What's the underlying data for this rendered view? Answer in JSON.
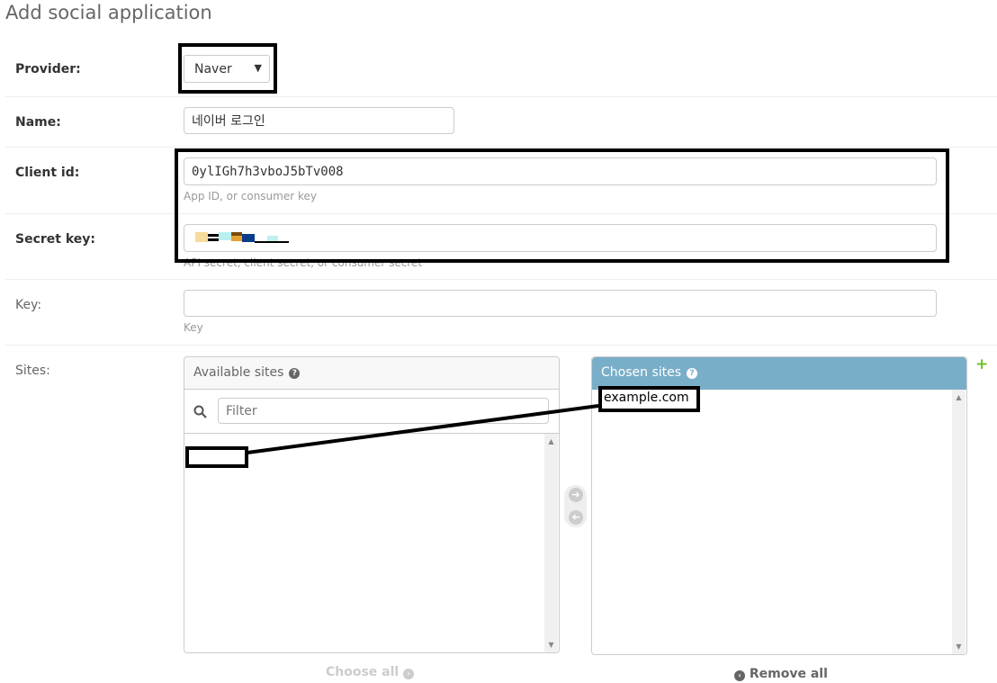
{
  "page": {
    "title": "Add social application"
  },
  "provider": {
    "label": "Provider:",
    "value": "Naver"
  },
  "name": {
    "label": "Name:",
    "value": "네이버 로그인"
  },
  "client_id": {
    "label": "Client id:",
    "value": "0ylIGh7h3vboJ5bTv008",
    "help": "App ID, or consumer key"
  },
  "secret_key": {
    "label": "Secret key:",
    "help": "API secret, client secret, or consumer secret"
  },
  "key": {
    "label": "Key:",
    "value": "",
    "help": "Key"
  },
  "sites": {
    "label": "Sites:",
    "available_title": "Available sites",
    "filter_placeholder": "Filter",
    "chosen_title": "Chosen sites",
    "chosen_items": [
      "example.com"
    ],
    "choose_all": "Choose all",
    "remove_all": "Remove all"
  },
  "colors": {
    "accent": "#79aec8",
    "add_green": "#70bf2b"
  }
}
